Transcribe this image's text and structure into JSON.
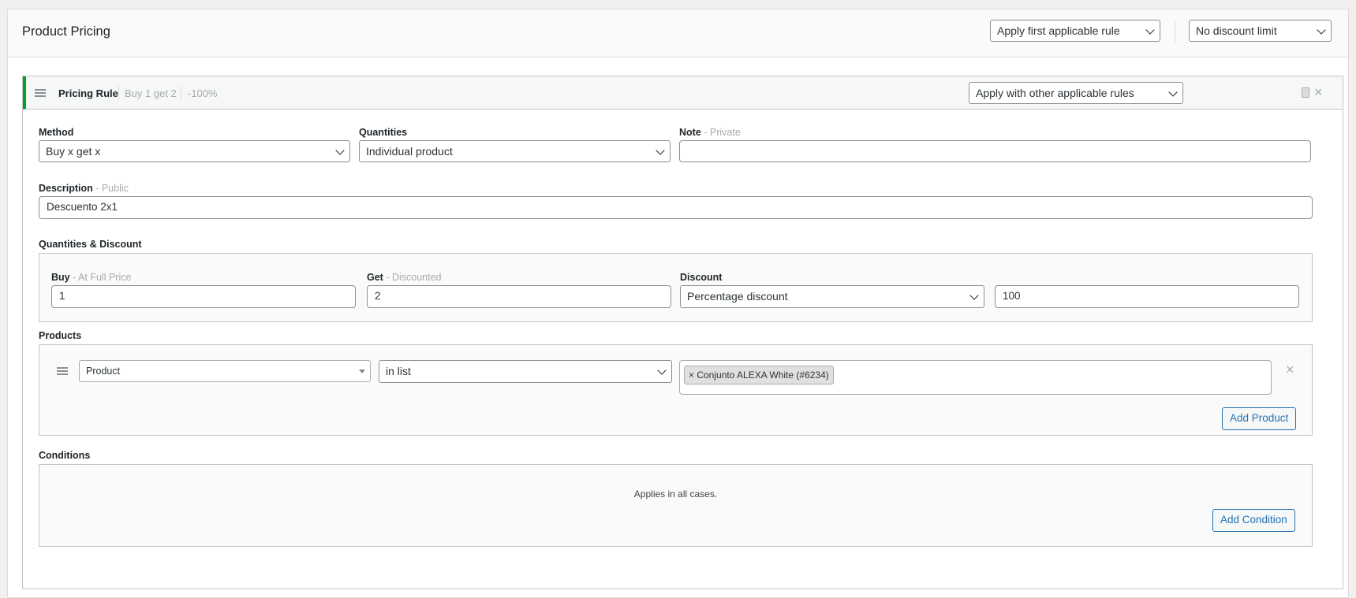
{
  "header": {
    "title": "Product Pricing",
    "rule_selection": "Apply first applicable rule",
    "discount_limit": "No discount limit"
  },
  "rule": {
    "title": "Pricing Rule",
    "summary_name": "Buy 1 get 2",
    "summary_discount": "-100%",
    "exclusivity": "Apply with other applicable rules",
    "accent_color": "#00a32a"
  },
  "fields": {
    "method": {
      "label": "Method",
      "value": "Buy x get x"
    },
    "quantities": {
      "label": "Quantities",
      "value": "Individual product"
    },
    "note": {
      "label": "Note",
      "sub": " - Private",
      "value": ""
    },
    "description": {
      "label": "Description",
      "sub": " - Public",
      "value": "Descuento 2x1"
    }
  },
  "quantities_discount": {
    "section_label": "Quantities & Discount",
    "buy_label": "Buy",
    "buy_sub": " - At Full Price",
    "buy_value": "1",
    "get_label": "Get",
    "get_sub": " - Discounted",
    "get_value": "2",
    "discount_label": "Discount",
    "discount_type": "Percentage discount",
    "discount_value": "100"
  },
  "products": {
    "section_label": "Products",
    "type": "Product",
    "operator": "in list",
    "chip": "× Conjunto ALEXA White (#6234)",
    "add_button": "Add Product"
  },
  "conditions": {
    "section_label": "Conditions",
    "empty_note": "Applies in all cases.",
    "add_button": "Add Condition"
  },
  "icons": [
    "drag-handle-icon",
    "duplicate-icon",
    "close-icon",
    "chevron-down-icon"
  ]
}
